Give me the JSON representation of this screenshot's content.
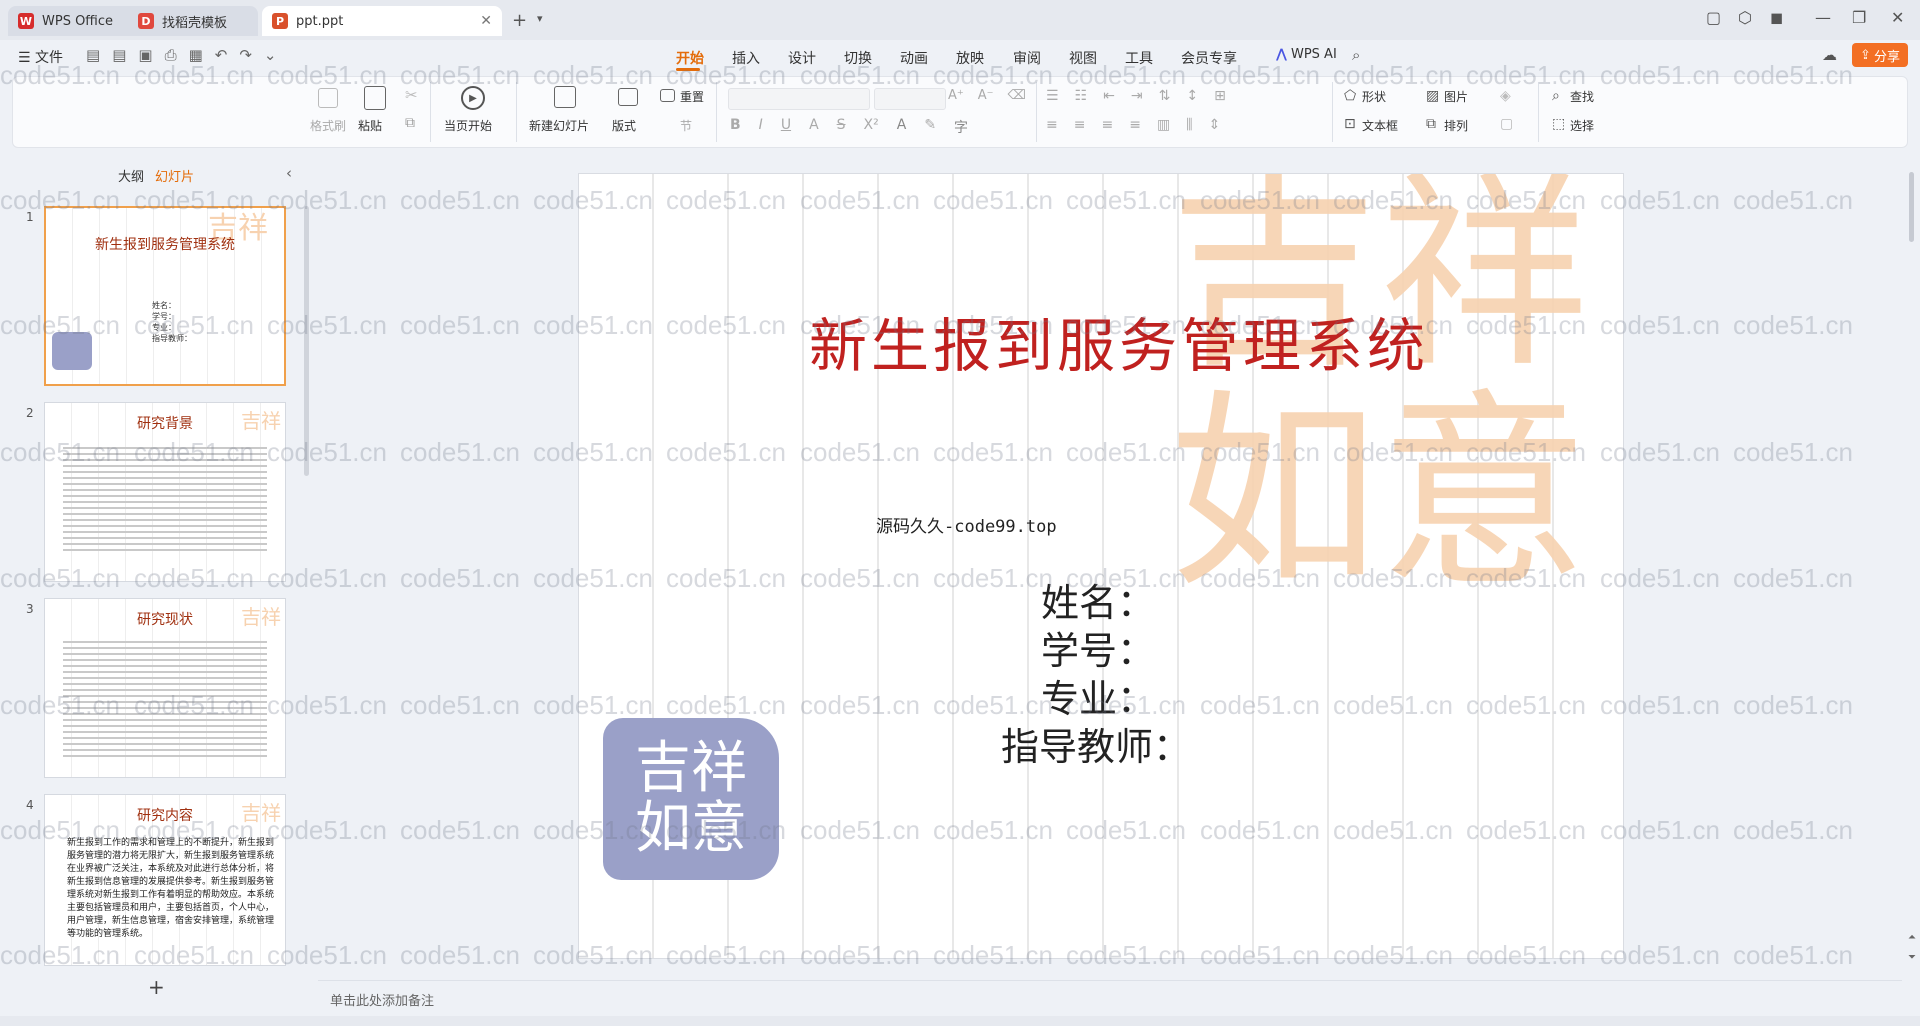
{
  "tabs": [
    {
      "label": "WPS Office",
      "icon": "wps-logo-icon"
    },
    {
      "label": "找稻壳模板",
      "icon": "docer-icon"
    },
    {
      "label": "ppt.ppt",
      "icon": "ppt-file-icon"
    }
  ],
  "menu": {
    "file": "文件",
    "items": [
      "开始",
      "插入",
      "设计",
      "切换",
      "动画",
      "放映",
      "审阅",
      "视图",
      "工具",
      "会员专享"
    ],
    "active": "开始",
    "wps_ai": "WPS AI",
    "share": "分享"
  },
  "ribbon": {
    "format_painter": "格式刷",
    "paste": "粘贴",
    "start_from_current": "当页开始",
    "new_slide": "新建幻灯片",
    "layout": "版式",
    "reset": "重置",
    "section": "节",
    "shape": "形状",
    "picture": "图片",
    "textbox": "文本框",
    "arrange": "排列",
    "find": "查找",
    "select": "选择"
  },
  "sidebar": {
    "outline_tab": "大纲",
    "slides_tab": "幻灯片",
    "add_button": "+",
    "slides": [
      {
        "num": "1",
        "title": "新生报到服务管理系统",
        "lines": [
          "姓名：",
          "学号：",
          "专业：",
          "指导教师："
        ]
      },
      {
        "num": "2",
        "title": "研究背景"
      },
      {
        "num": "3",
        "title": "研究现状"
      },
      {
        "num": "4",
        "title": "研究内容",
        "body": "新生报到工作的需求和管理上的不断提升，新生报到服务管理的潜力将无限扩大，新生报到服务管理系统在业界被广泛关注，本系统及对此进行总体分析，将新生报到信息管理的发展提供参考。新生报到服务管理系统对新生报到工作有着明显的帮助效应。本系统主要包括管理员和用户，主要包括首页，个人中心，用户管理，新生信息管理，宿舍安排管理，系统管理等功能的管理系统。"
      }
    ]
  },
  "slide": {
    "title": "新生报到服务管理系统",
    "subtitle": "源码久久-code99.top",
    "fields": [
      "姓名：",
      "学号：",
      "专业：",
      "指导教师："
    ],
    "seal_text": "吉祥如意"
  },
  "notes_placeholder": "单击此处添加备注",
  "watermark": "code51.cn",
  "colors": {
    "accent": "#e46c0a",
    "title_red": "#c0211f",
    "seal_orange": "#f7d2b0",
    "seal_blue": "#9aa0c8"
  }
}
